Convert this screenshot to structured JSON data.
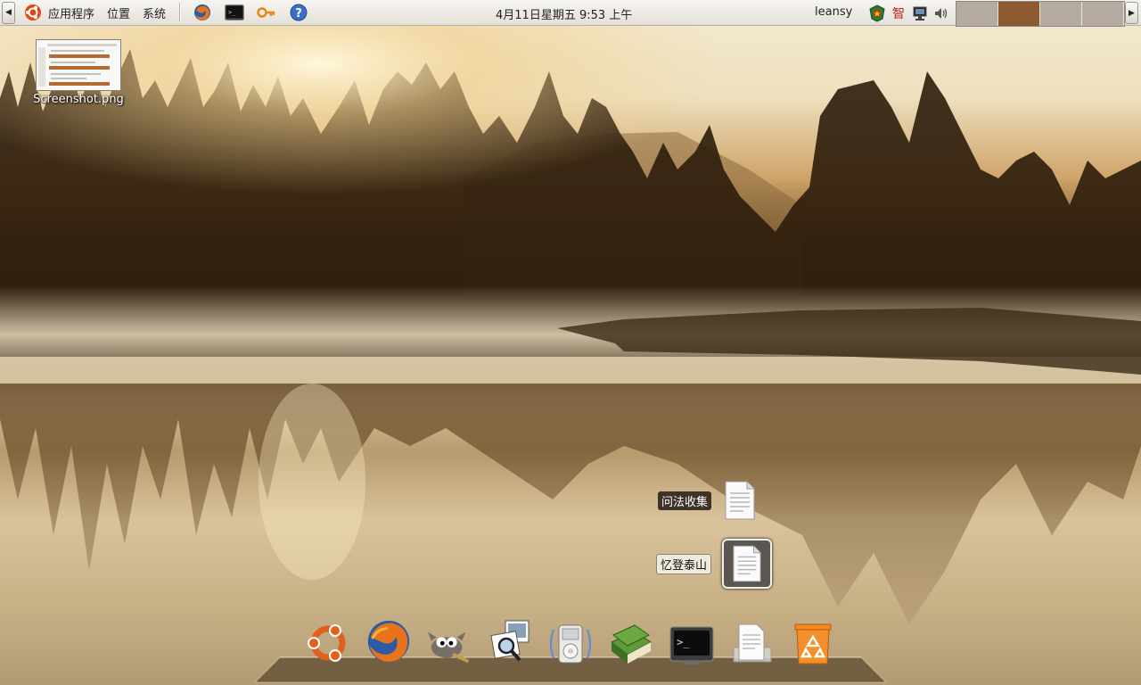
{
  "panel": {
    "menus": [
      "应用程序",
      "位置",
      "系统"
    ],
    "launchers": [
      "firefox-icon",
      "terminal-icon",
      "network-keys-icon",
      "help-icon"
    ],
    "clock": "4月11日星期五   9:53 上午",
    "user": "leansy",
    "tray_icons": [
      "antivirus-icon",
      "input-method-icon",
      "network-monitor-icon",
      "volume-icon"
    ],
    "workspaces": [
      {
        "active": false
      },
      {
        "active": true
      },
      {
        "active": false
      },
      {
        "active": false
      }
    ]
  },
  "desktop": {
    "icons": [
      {
        "label": "Screenshot.png",
        "icon": "image-file-icon"
      }
    ]
  },
  "stack": {
    "items": [
      {
        "label": "问法收集",
        "icon": "text-document-icon"
      },
      {
        "label": "忆登泰山",
        "icon": "text-document-icon"
      }
    ]
  },
  "dock": {
    "items": [
      "ubuntu-logo-icon",
      "firefox-icon",
      "gimp-icon",
      "image-viewer-icon",
      "music-player-icon",
      "books-icon",
      "terminal-icon",
      "documents-icon",
      "trash-icon"
    ]
  },
  "colors": {
    "panel": "#ece9e3",
    "workspace_active": "#8e5a31",
    "workspace_inactive": "#b6aba0"
  }
}
